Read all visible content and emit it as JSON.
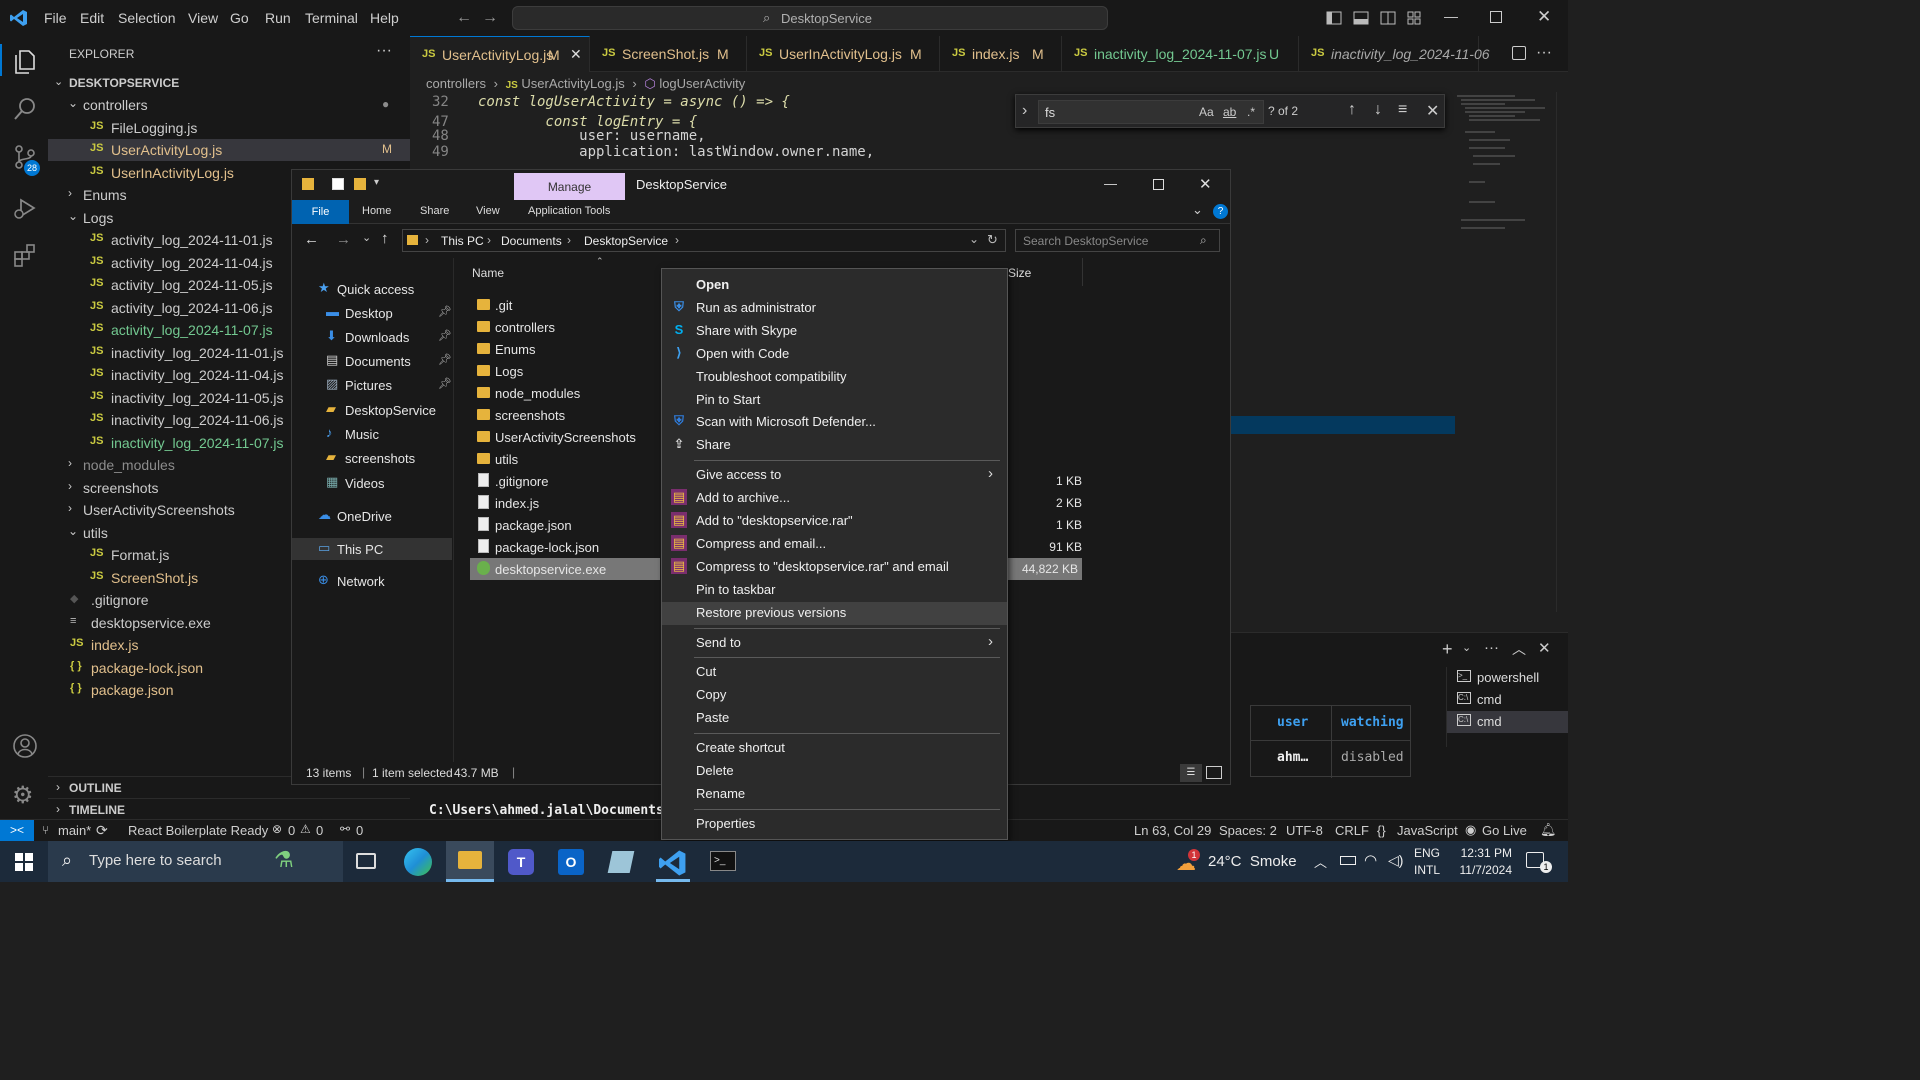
{
  "vscode": {
    "menu": [
      "File",
      "Edit",
      "Selection",
      "View",
      "Go",
      "Run",
      "Terminal",
      "Help"
    ],
    "command_center": "DesktopService",
    "scm_badge": "28",
    "explorer_title": "EXPLORER",
    "workspace": "DESKTOPSERVICE",
    "tree": [
      {
        "label": "controllers",
        "kind": "folder-open",
        "indent": 1,
        "badge": "●"
      },
      {
        "label": "FileLogging.js",
        "kind": "js",
        "indent": 2,
        "color": "#cccccc"
      },
      {
        "label": "UserActivityLog.js",
        "kind": "js",
        "indent": 2,
        "color": "#e2c08d",
        "badge": "M",
        "selected": true
      },
      {
        "label": "UserInActivityLog.js",
        "kind": "js",
        "indent": 2,
        "color": "#e2c08d"
      },
      {
        "label": "Enums",
        "kind": "folder",
        "indent": 1
      },
      {
        "label": "Logs",
        "kind": "folder-open",
        "indent": 1
      },
      {
        "label": "activity_log_2024-11-01.js",
        "kind": "js",
        "indent": 2,
        "color": "#cccccc"
      },
      {
        "label": "activity_log_2024-11-04.js",
        "kind": "js",
        "indent": 2,
        "color": "#cccccc"
      },
      {
        "label": "activity_log_2024-11-05.js",
        "kind": "js",
        "indent": 2,
        "color": "#cccccc"
      },
      {
        "label": "activity_log_2024-11-06.js",
        "kind": "js",
        "indent": 2,
        "color": "#cccccc"
      },
      {
        "label": "activity_log_2024-11-07.js",
        "kind": "js",
        "indent": 2,
        "color": "#73c991"
      },
      {
        "label": "inactivity_log_2024-11-01.js",
        "kind": "js",
        "indent": 2,
        "color": "#cccccc"
      },
      {
        "label": "inactivity_log_2024-11-04.js",
        "kind": "js",
        "indent": 2,
        "color": "#cccccc"
      },
      {
        "label": "inactivity_log_2024-11-05.js",
        "kind": "js",
        "indent": 2,
        "color": "#cccccc"
      },
      {
        "label": "inactivity_log_2024-11-06.js",
        "kind": "js",
        "indent": 2,
        "color": "#cccccc"
      },
      {
        "label": "inactivity_log_2024-11-07.js",
        "kind": "js",
        "indent": 2,
        "color": "#73c991"
      },
      {
        "label": "node_modules",
        "kind": "folder",
        "indent": 1,
        "color": "#8c8c8c"
      },
      {
        "label": "screenshots",
        "kind": "folder",
        "indent": 1
      },
      {
        "label": "UserActivityScreenshots",
        "kind": "folder",
        "indent": 1
      },
      {
        "label": "utils",
        "kind": "folder-open",
        "indent": 1
      },
      {
        "label": "Format.js",
        "kind": "js",
        "indent": 2,
        "color": "#cccccc"
      },
      {
        "label": "ScreenShot.js",
        "kind": "js",
        "indent": 2,
        "color": "#e2c08d"
      },
      {
        "label": ".gitignore",
        "kind": "git",
        "indent": 1,
        "color": "#cccccc"
      },
      {
        "label": "desktopservice.exe",
        "kind": "exe",
        "indent": 1,
        "color": "#cccccc"
      },
      {
        "label": "index.js",
        "kind": "js",
        "indent": 1,
        "color": "#e2c08d"
      },
      {
        "label": "package-lock.json",
        "kind": "json",
        "indent": 1,
        "color": "#e2c08d"
      },
      {
        "label": "package.json",
        "kind": "json",
        "indent": 1,
        "color": "#e2c08d"
      }
    ],
    "outline": "OUTLINE",
    "timeline": "TIMELINE",
    "tabs": [
      {
        "label": "UserActivityLog.js",
        "badge": "M",
        "active": true
      },
      {
        "label": "ScreenShot.js",
        "badge": "M"
      },
      {
        "label": "UserInActivityLog.js",
        "badge": "M"
      },
      {
        "label": "index.js",
        "badge": "M"
      },
      {
        "label": "inactivity_log_2024-11-07.js",
        "badge": "U"
      },
      {
        "label": "inactivity_log_2024-11-06"
      }
    ],
    "breadcrumb": [
      "controllers",
      "UserActivityLog.js",
      "logUserActivity"
    ],
    "code": [
      {
        "num": "32",
        "text": "const logUserActivity = async () => {"
      },
      {
        "num": "47",
        "text": "        const logEntry = {"
      },
      {
        "num": "48",
        "text": "            user: username,"
      },
      {
        "num": "49",
        "text": "            application: lastWindow.owner.name,"
      }
    ],
    "find": {
      "query": "fs",
      "result": "? of 2",
      "case": "Aa",
      "word": "ab",
      "regex": ".*"
    },
    "terminal": {
      "prompt": "C:\\Users\\ahmed.jalal\\Documents\\D",
      "headers": [
        "user",
        "watching"
      ],
      "cells": [
        "ahm…",
        "disabled"
      ],
      "sessions": [
        "powershell",
        "cmd",
        "cmd"
      ]
    },
    "status": {
      "branch": "main*",
      "extension": "React Boilerplate Ready",
      "errors": "0",
      "warnings": "0",
      "ports": "0",
      "position": "Ln 63, Col 29",
      "spaces": "Spaces: 2",
      "encoding": "UTF-8",
      "eol": "CRLF",
      "language": "JavaScript",
      "golive": "Go Live"
    }
  },
  "explorer": {
    "manage": "Manage",
    "title": "DesktopService",
    "ribbon": [
      "File",
      "Home",
      "Share",
      "View",
      "Application Tools"
    ],
    "path": [
      "This PC",
      "Documents",
      "DesktopService"
    ],
    "search_placeholder": "Search DesktopService",
    "col_name": "Name",
    "col_size": "Size",
    "nav": [
      {
        "label": "Quick access",
        "icon": "star",
        "indent": 0,
        "pinned": false
      },
      {
        "label": "Desktop",
        "icon": "desktop",
        "indent": 1,
        "pinned": true
      },
      {
        "label": "Downloads",
        "icon": "download",
        "indent": 1,
        "pinned": true
      },
      {
        "label": "Documents",
        "icon": "document",
        "indent": 1,
        "pinned": true
      },
      {
        "label": "Pictures",
        "icon": "picture",
        "indent": 1,
        "pinned": true
      },
      {
        "label": "DesktopService",
        "icon": "folder",
        "indent": 1,
        "pinned": false
      },
      {
        "label": "Music",
        "icon": "music",
        "indent": 1,
        "pinned": false
      },
      {
        "label": "screenshots",
        "icon": "folder",
        "indent": 1,
        "pinned": false
      },
      {
        "label": "Videos",
        "icon": "video",
        "indent": 1,
        "pinned": false
      },
      {
        "label": "OneDrive",
        "icon": "cloud",
        "indent": 0,
        "pinned": false
      },
      {
        "label": "This PC",
        "icon": "pc",
        "indent": 0,
        "pinned": false,
        "selected": true
      },
      {
        "label": "Network",
        "icon": "network",
        "indent": 0,
        "pinned": false
      }
    ],
    "files": [
      {
        "name": ".git",
        "type": "folder",
        "size": ""
      },
      {
        "name": "controllers",
        "type": "folder",
        "size": ""
      },
      {
        "name": "Enums",
        "type": "folder",
        "size": ""
      },
      {
        "name": "Logs",
        "type": "folder",
        "size": ""
      },
      {
        "name": "node_modules",
        "type": "folder",
        "size": ""
      },
      {
        "name": "screenshots",
        "type": "folder",
        "size": ""
      },
      {
        "name": "UserActivityScreenshots",
        "type": "folder",
        "size": ""
      },
      {
        "name": "utils",
        "type": "folder",
        "size": ""
      },
      {
        "name": ".gitignore",
        "type": "file",
        "size": "1 KB"
      },
      {
        "name": "index.js",
        "type": "js",
        "size": "2 KB"
      },
      {
        "name": "package.json",
        "type": "file",
        "size": "1 KB"
      },
      {
        "name": "package-lock.json",
        "type": "file",
        "size": "91 KB"
      },
      {
        "name": "desktopservice.exe",
        "type": "exe",
        "size": "44,822 KB",
        "selected": true
      }
    ],
    "status": {
      "items": "13 items",
      "selected": "1 item selected",
      "size": "43.7 MB"
    }
  },
  "context_menu": [
    {
      "label": "Open",
      "bold": true,
      "icon": ""
    },
    {
      "label": "Run as administrator",
      "icon": "shield"
    },
    {
      "label": "Share with Skype",
      "icon": "skype"
    },
    {
      "label": "Open with Code",
      "icon": "vscode"
    },
    {
      "label": "Troubleshoot compatibility",
      "icon": ""
    },
    {
      "label": "Pin to Start",
      "icon": ""
    },
    {
      "label": "Scan with Microsoft Defender...",
      "icon": "defender"
    },
    {
      "label": "Share",
      "icon": "share"
    },
    {
      "sep": true
    },
    {
      "label": "Give access to",
      "icon": "",
      "arrow": true
    },
    {
      "label": "Add to archive...",
      "icon": "rar"
    },
    {
      "label": "Add to \"desktopservice.rar\"",
      "icon": "rar"
    },
    {
      "label": "Compress and email...",
      "icon": "rar"
    },
    {
      "label": "Compress to \"desktopservice.rar\" and email",
      "icon": "rar"
    },
    {
      "label": "Pin to taskbar",
      "icon": ""
    },
    {
      "label": "Restore previous versions",
      "icon": "",
      "hover": true
    },
    {
      "sep": true
    },
    {
      "label": "Send to",
      "icon": "",
      "arrow": true
    },
    {
      "sep": true
    },
    {
      "label": "Cut",
      "icon": ""
    },
    {
      "label": "Copy",
      "icon": ""
    },
    {
      "label": "Paste",
      "icon": ""
    },
    {
      "sep": true
    },
    {
      "label": "Create shortcut",
      "icon": ""
    },
    {
      "label": "Delete",
      "icon": ""
    },
    {
      "label": "Rename",
      "icon": ""
    },
    {
      "sep": true
    },
    {
      "label": "Properties",
      "icon": ""
    }
  ],
  "taskbar": {
    "search_placeholder": "Type here to search",
    "weather": "24°C  Smoke",
    "weather_badge": "1",
    "lang1": "ENG",
    "lang2": "INTL",
    "time": "12:31 PM",
    "date": "11/7/2024",
    "notif": "1"
  },
  "colors": {
    "accent": "#0078d4",
    "vscode_bg": "#1f1f1f",
    "selection": "#04395e",
    "manage_tab": "#e0c7f5"
  }
}
